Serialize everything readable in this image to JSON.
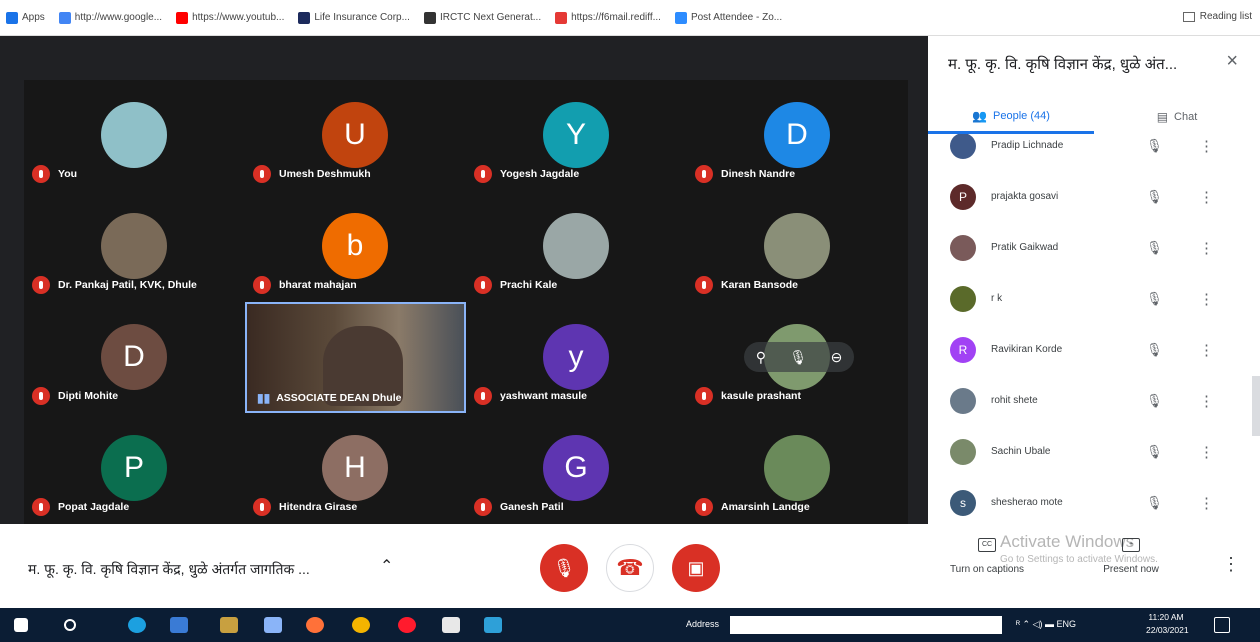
{
  "bookmarks": [
    {
      "label": "Apps",
      "color": "#1a73e8"
    },
    {
      "label": "http://www.google...",
      "color": "#4285f4"
    },
    {
      "label": "https://www.youtub...",
      "color": "#ff0000"
    },
    {
      "label": "Life Insurance Corp...",
      "color": "#1c2a5c"
    },
    {
      "label": "IRCTC Next Generat...",
      "color": "#333333"
    },
    {
      "label": "https://f6mail.rediff...",
      "color": "#e53935"
    },
    {
      "label": "Post Attendee - Zo...",
      "color": "#2d8cff"
    }
  ],
  "reading_list": "Reading list",
  "tiles": [
    {
      "name": "You",
      "initial": "",
      "color": "#8fc0c8"
    },
    {
      "name": "Umesh Deshmukh",
      "initial": "U",
      "color": "#c1440e"
    },
    {
      "name": "Yogesh Jagdale",
      "initial": "Y",
      "color": "#129eaf"
    },
    {
      "name": "Dinesh Nandre",
      "initial": "D",
      "color": "#1e88e5"
    },
    {
      "name": "Dr. Pankaj Patil, KVK, Dhule",
      "initial": "",
      "color": "#7a6a58"
    },
    {
      "name": "bharat mahajan",
      "initial": "b",
      "color": "#ef6c00"
    },
    {
      "name": "Prachi Kale",
      "initial": "",
      "color": "#9aa7a6"
    },
    {
      "name": "Karan Bansode",
      "initial": "",
      "color": "#8a8f78"
    },
    {
      "name": "Dipti Mohite",
      "initial": "D",
      "color": "#6d4c41"
    },
    {
      "name": "ASSOCIATE DEAN Dhule",
      "initial": "",
      "color": "#5b4a3a"
    },
    {
      "name": "yashwant masule",
      "initial": "y",
      "color": "#5e35b1"
    },
    {
      "name": "kasule prashant",
      "initial": "",
      "color": "#7f9a6e"
    },
    {
      "name": "Popat Jagdale",
      "initial": "P",
      "color": "#0b6e4f"
    },
    {
      "name": "Hitendra Girase",
      "initial": "H",
      "color": "#8d6e63"
    },
    {
      "name": "Ganesh Patil",
      "initial": "G",
      "color": "#5e35b1"
    },
    {
      "name": "Amarsinh Landge",
      "initial": "",
      "color": "#6a8a5a"
    }
  ],
  "panel": {
    "title": "म. फू. कृ. वि. कृषि विज्ञान केंद्र, धुळे अंत...",
    "close": "×",
    "tab_people": "People (44)",
    "tab_chat": "Chat"
  },
  "people": [
    {
      "name": "Pradip Lichnade",
      "initial": "",
      "color": "#3f5a8a"
    },
    {
      "name": "prajakta gosavi",
      "initial": "P",
      "color": "#5d2a2a"
    },
    {
      "name": "Pratik Gaikwad",
      "initial": "",
      "color": "#7a5a5a"
    },
    {
      "name": "r k",
      "initial": "",
      "color": "#5a6a2a"
    },
    {
      "name": "Ravikiran Korde",
      "initial": "R",
      "color": "#a142f4"
    },
    {
      "name": "rohit shete",
      "initial": "",
      "color": "#6a7a8a"
    },
    {
      "name": "Sachin Ubale",
      "initial": "",
      "color": "#7a8a6a"
    },
    {
      "name": "shesherao mote",
      "initial": "s",
      "color": "#3c5a78"
    }
  ],
  "bottom": {
    "meeting_title": "म. फू. कृ. वि. कृषि विज्ञान केंद्र, धुळे अंतर्गत जागतिक ...",
    "captions": "Turn on captions",
    "present": "Present now",
    "watermark_title": "Activate Windows",
    "watermark_sub": "Go to Settings to activate Windows."
  },
  "taskbar": {
    "address_label": "Address",
    "tray": "ENG",
    "time": "11:20 AM",
    "date": "22/03/2021"
  },
  "colors": {
    "end_call": "#d93025",
    "accent": "#1a73e8"
  }
}
